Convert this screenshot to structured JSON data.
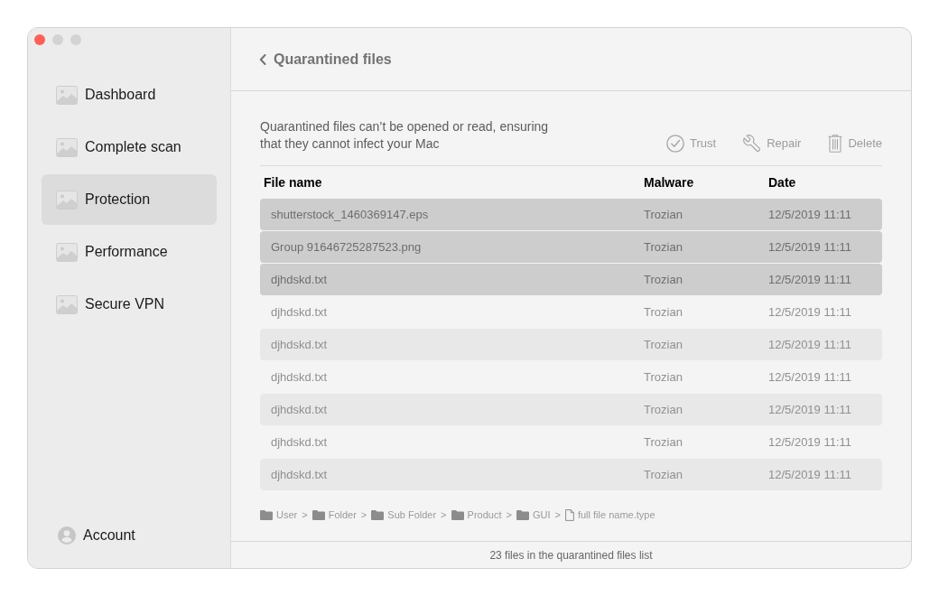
{
  "window": {
    "controls": [
      {
        "kind": "close",
        "disabled": false
      },
      {
        "kind": "minimize",
        "disabled": true
      },
      {
        "kind": "zoom",
        "disabled": true
      }
    ]
  },
  "sidebar": {
    "items": [
      {
        "label": "Dashboard",
        "selected": false
      },
      {
        "label": "Complete scan",
        "selected": false
      },
      {
        "label": "Protection",
        "selected": true
      },
      {
        "label": "Performance",
        "selected": false
      },
      {
        "label": "Secure VPN",
        "selected": false
      }
    ],
    "account": {
      "label": "Account"
    }
  },
  "header": {
    "title": "Quarantined files"
  },
  "description": "Quarantined files can’t be opened or read, ensuring that they cannot infect your Mac",
  "actions": [
    {
      "kind": "trust",
      "label": "Trust"
    },
    {
      "kind": "repair",
      "label": "Repair"
    },
    {
      "kind": "delete",
      "label": "Delete"
    }
  ],
  "table": {
    "columns": [
      "File name",
      "Malware",
      "Date"
    ],
    "rows": [
      {
        "file_name": "shutterstock_1460369147.eps",
        "malware": "Trozian",
        "date": "12/5/2019 11:11",
        "selected": true
      },
      {
        "file_name": "Group 91646725287523.png",
        "malware": "Trozian",
        "date": "12/5/2019 11:11",
        "selected": true
      },
      {
        "file_name": "djhdskd.txt",
        "malware": "Trozian",
        "date": "12/5/2019 11:11",
        "selected": true
      },
      {
        "file_name": "djhdskd.txt",
        "malware": "Trozian",
        "date": "12/5/2019 11:11",
        "selected": false
      },
      {
        "file_name": "djhdskd.txt",
        "malware": "Trozian",
        "date": "12/5/2019 11:11",
        "selected": false
      },
      {
        "file_name": "djhdskd.txt",
        "malware": "Trozian",
        "date": "12/5/2019 11:11",
        "selected": false
      },
      {
        "file_name": "djhdskd.txt",
        "malware": "Trozian",
        "date": "12/5/2019 11:11",
        "selected": false
      },
      {
        "file_name": "djhdskd.txt",
        "malware": "Trozian",
        "date": "12/5/2019 11:11",
        "selected": false
      },
      {
        "file_name": "djhdskd.txt",
        "malware": "Trozian",
        "date": "12/5/2019 11:11",
        "selected": false
      }
    ]
  },
  "breadcrumb": {
    "items": [
      {
        "kind": "folder",
        "label": "User",
        "separator": ">"
      },
      {
        "kind": "folder",
        "label": "Folder",
        "separator": ">"
      },
      {
        "kind": "folder",
        "label": "Sub Folder",
        "separator": ">"
      },
      {
        "kind": "folder",
        "label": "Product",
        "separator": ">"
      },
      {
        "kind": "folder",
        "label": "GUI",
        "separator": ">"
      },
      {
        "kind": "file",
        "label": "full file name.type"
      }
    ]
  },
  "status_bar": "23 files in the quarantined files list"
}
